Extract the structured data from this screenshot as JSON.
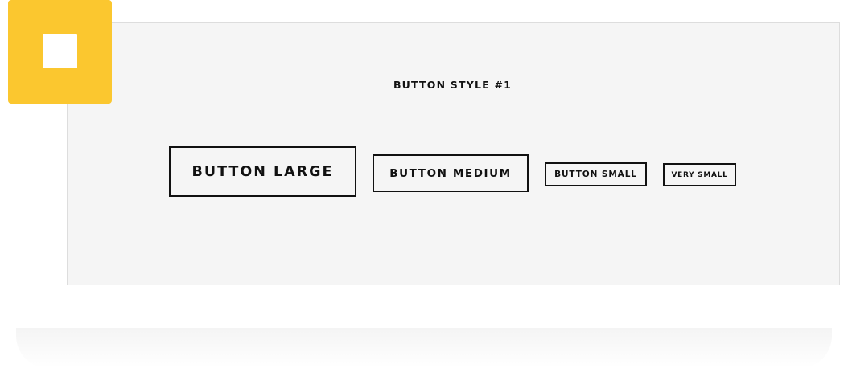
{
  "section": {
    "title": "BUTTON STYLE #1"
  },
  "badge": {
    "icon": "square-icon",
    "color": "#fbc72f"
  },
  "buttons": {
    "large": "BUTTON LARGE",
    "medium": "BUTTON MEDIUM",
    "small": "BUTTON SMALL",
    "very_small": "VERY SMALL"
  },
  "colors": {
    "panel_background": "#f5f5f5",
    "button_border": "#111111",
    "accent": "#fbc72f"
  }
}
